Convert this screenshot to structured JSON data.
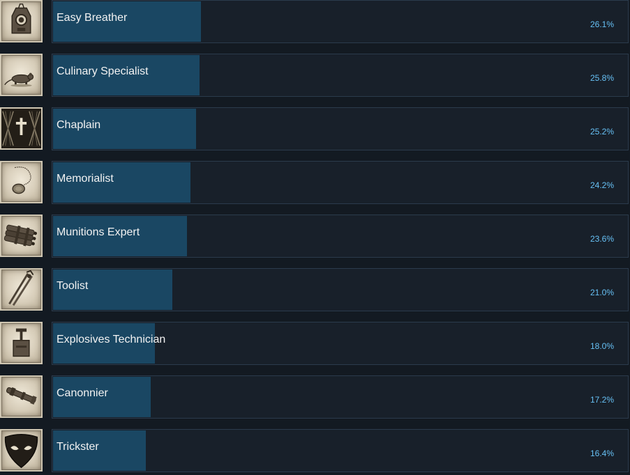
{
  "achievements": [
    {
      "name": "Easy Breather",
      "percent": "26.1%",
      "value": 26.1,
      "icon": "gas-mask-icon"
    },
    {
      "name": "Culinary Specialist",
      "percent": "25.8%",
      "value": 25.8,
      "icon": "rat-icon"
    },
    {
      "name": "Chaplain",
      "percent": "25.2%",
      "value": 25.2,
      "icon": "cross-icon"
    },
    {
      "name": "Memorialist",
      "percent": "24.2%",
      "value": 24.2,
      "icon": "dog-tag-icon"
    },
    {
      "name": "Munitions Expert",
      "percent": "23.6%",
      "value": 23.6,
      "icon": "dynamite-icon"
    },
    {
      "name": "Toolist",
      "percent": "21.0%",
      "value": 21.0,
      "icon": "bolt-cutter-icon"
    },
    {
      "name": "Explosives Technician",
      "percent": "18.0%",
      "value": 18.0,
      "icon": "detonator-icon"
    },
    {
      "name": "Canonnier",
      "percent": "17.2%",
      "value": 17.2,
      "icon": "cannon-icon"
    },
    {
      "name": "Trickster",
      "percent": "16.4%",
      "value": 16.4,
      "icon": "mask-icon"
    }
  ],
  "colors": {
    "background": "#131a22",
    "bar_fill": "#1a4763",
    "bar_border": "#2b3b4c",
    "percent_text": "#67c1f5"
  }
}
